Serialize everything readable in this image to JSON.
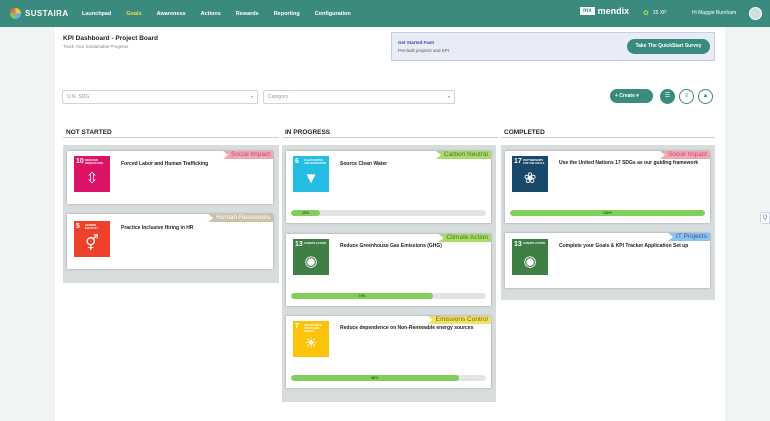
{
  "brand": {
    "name": "SUSTAIRA"
  },
  "nav": [
    {
      "label": "Launchpad"
    },
    {
      "label": "Goals",
      "active": true
    },
    {
      "label": "Awareness"
    },
    {
      "label": "Actions"
    },
    {
      "label": "Rewards"
    },
    {
      "label": "Reporting"
    },
    {
      "label": "Configuration"
    }
  ],
  "topbar": {
    "mendix_box": "mx",
    "mendix_word": "mendix",
    "xp": "25 XP",
    "greeting": "Hi Maggie Burnham"
  },
  "page": {
    "title": "KPI Dashboard - Project Board",
    "subtitle": "Track Your Sustainable Progress"
  },
  "get_started": {
    "title": "Get Started Fast!",
    "subtitle": "Pre-built projects and KPI",
    "button": "Take The QuickStart Survey"
  },
  "filters": {
    "sdg": "U.N. SDG",
    "category": "Category"
  },
  "toolbar": {
    "create": "+ Create ▾",
    "view_list_icon": "☰",
    "view_grid_icon": "≡",
    "view_chart_icon": "▲"
  },
  "columns": [
    {
      "title": "NOT STARTED"
    },
    {
      "title": "IN PROGRESS"
    },
    {
      "title": "COMPLETED"
    }
  ],
  "cards": {
    "c1": {
      "tag": "Social Impact",
      "tag_color": "#f0a8b4",
      "sdg_num": "10",
      "sdg_caption": "REDUCED INEQUALITIES",
      "sdg_color": "#dd1367",
      "sdg_icon": "⇳",
      "title": "Forced Labor and Human Trafficking"
    },
    "c2": {
      "tag": "Human Resources",
      "tag_color": "#c9c3a8",
      "sdg_num": "5",
      "sdg_caption": "GENDER EQUALITY",
      "sdg_color": "#ef402b",
      "sdg_icon": "⚥",
      "title": "Practice Inclusive Hiring in HR"
    },
    "c3": {
      "tag": "Carbon Neutral",
      "tag_color": "#a9da6b",
      "sdg_num": "6",
      "sdg_caption": "CLEAN WATER AND SANITATION",
      "sdg_color": "#26bde2",
      "sdg_icon": "▼",
      "title": "Source Clean Water",
      "progress_label": "15%",
      "progress": 15
    },
    "c4": {
      "tag": "Climate Action",
      "tag_color": "#a9da6b",
      "sdg_num": "13",
      "sdg_caption": "CLIMATE ACTION",
      "sdg_color": "#3f7e44",
      "sdg_icon": "◉",
      "title": "Reduce Greenhouse Gas Emissions (GHG)",
      "progress_label": "73%",
      "progress": 73
    },
    "c5": {
      "tag": "Emissions Control",
      "tag_color": "#efe06a",
      "sdg_num": "7",
      "sdg_caption": "AFFORDABLE AND CLEAN ENERGY",
      "sdg_color": "#fcc30b",
      "sdg_icon": "☀",
      "title": "Reduce dependence on Non-Renewable energy sources",
      "progress_label": "86%",
      "progress": 86
    },
    "c6": {
      "tag": "Social Impact",
      "tag_color": "#f0a8b4",
      "sdg_num": "17",
      "sdg_caption": "PARTNERSHIPS FOR THE GOALS",
      "sdg_color": "#19486a",
      "sdg_icon": "❀",
      "title": "Use the United Nations 17 SDGs as our guiding framework",
      "progress_label": "100%",
      "progress": 100
    },
    "c7": {
      "tag": "IT Projects",
      "tag_color": "#8fc1ee",
      "sdg_num": "13",
      "sdg_caption": "CLIMATE ACTION",
      "sdg_color": "#3f7e44",
      "sdg_icon": "◉",
      "title": "Complete your Goals & KPI Tracker Application Set up"
    }
  },
  "side_tab": "Q"
}
